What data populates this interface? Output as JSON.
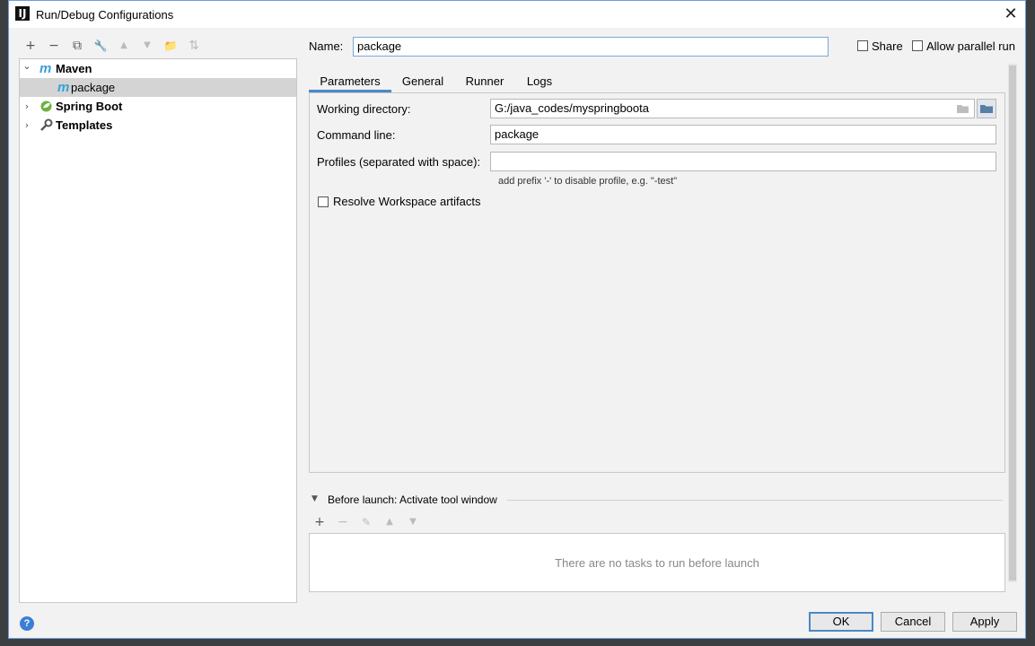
{
  "window": {
    "title": "Run/Debug Configurations",
    "app_icon": "intellij-icon"
  },
  "toolbar": {
    "add": "+",
    "remove": "−",
    "copy": "⧉",
    "edit": "🔧",
    "up": "▲",
    "down": "▼",
    "folder": "📁",
    "sort": "⇅"
  },
  "tree": {
    "items": [
      {
        "label": "Maven",
        "icon": "m",
        "arrow": "⌄"
      },
      {
        "label": "package",
        "icon": "m"
      },
      {
        "label": "Spring Boot",
        "icon": "spring-boot-icon",
        "arrow": "›"
      },
      {
        "label": "Templates",
        "icon": "wrench-icon",
        "arrow": "›"
      }
    ]
  },
  "name_field": {
    "label": "Name:",
    "value": "package"
  },
  "options": {
    "share": "Share",
    "allow_parallel": "Allow parallel run"
  },
  "tabs": [
    "Parameters",
    "General",
    "Runner",
    "Logs"
  ],
  "parameters": {
    "working_dir_label": "Working directory:",
    "working_dir_value": "G:/java_codes/myspringboota",
    "command_line_label": "Command line:",
    "command_line_value": "package",
    "profiles_label": "Profiles (separated with space):",
    "profiles_value": "",
    "profiles_hint": "add prefix '-' to disable profile, e.g. \"-test\"",
    "resolve_workspace_label": "Resolve Workspace artifacts"
  },
  "before_launch": {
    "title": "Before launch: Activate tool window",
    "add": "+",
    "remove": "−",
    "edit": "✎",
    "up": "▲",
    "down": "▼",
    "empty_text": "There are no tasks to run before launch"
  },
  "buttons": {
    "ok": "OK",
    "cancel": "Cancel",
    "apply": "Apply",
    "help": "?"
  },
  "colors": {
    "accent": "#4a88c7",
    "maven": "#3a9fd6",
    "spring": "#6db33f"
  }
}
